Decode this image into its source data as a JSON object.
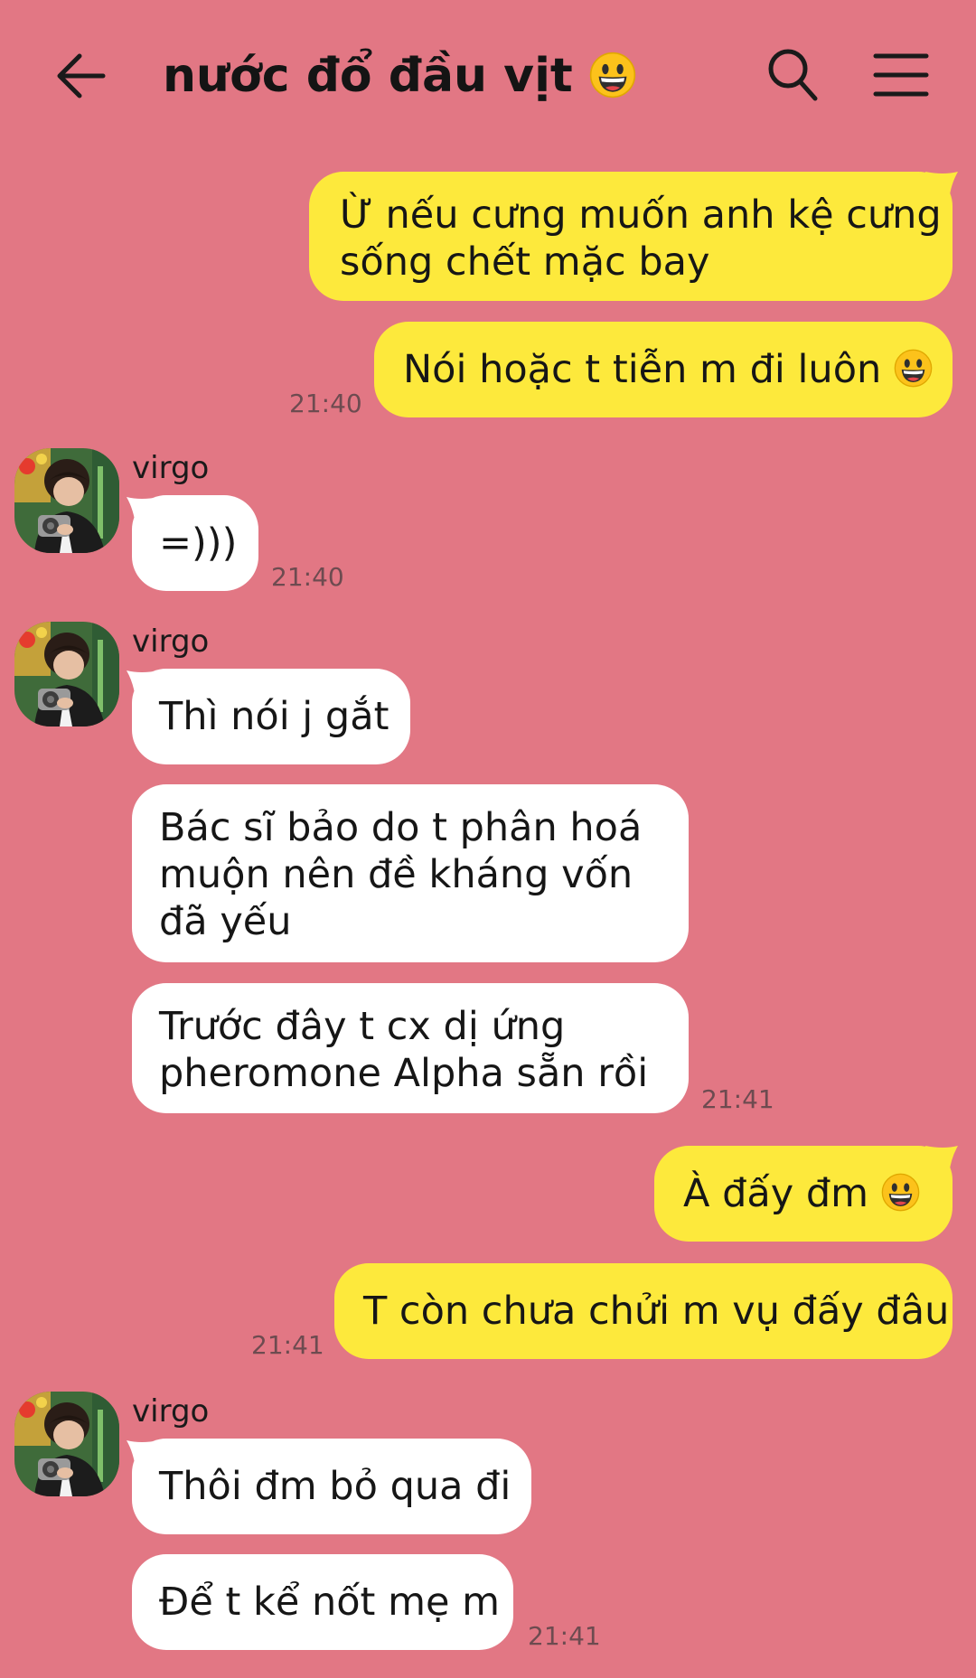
{
  "header": {
    "title": "nước đổ đầu vịt",
    "title_emoji": "grinning-face-emoji"
  },
  "messages": [
    {
      "id": "m1",
      "side": "out",
      "lines": [
        "Ừ nếu cưng muốn anh kệ cưng",
        "sống chết mặc bay"
      ]
    },
    {
      "id": "m2",
      "side": "out",
      "text": "Nói hoặc t tiễn m đi luôn",
      "emoji": "grinning-face-emoji",
      "time": "21:40"
    },
    {
      "id": "m3",
      "side": "in",
      "sender": "virgo",
      "text": "=)))",
      "time": "21:40"
    },
    {
      "id": "m4",
      "side": "in",
      "sender": "virgo",
      "text": "Thì nói j gắt"
    },
    {
      "id": "m5",
      "side": "in",
      "lines": [
        "Bác sĩ bảo do t phân hoá",
        "muộn nên đề kháng vốn",
        "đã yếu"
      ]
    },
    {
      "id": "m6",
      "side": "in",
      "lines": [
        "Trước đây t cx dị ứng",
        "pheromone Alpha sẵn rồi"
      ],
      "time": "21:41"
    },
    {
      "id": "m7",
      "side": "out",
      "text": "À đấy đm",
      "emoji": "grinning-face-emoji"
    },
    {
      "id": "m8",
      "side": "out",
      "text": "T còn chưa chửi m vụ đấy đâu",
      "time": "21:41"
    },
    {
      "id": "m9",
      "side": "in",
      "sender": "virgo",
      "text": "Thôi đm bỏ qua đi"
    },
    {
      "id": "m10",
      "side": "in",
      "text": "Để t kể nốt mẹ m",
      "time": "21:41"
    }
  ],
  "colors": {
    "background": "#e27784",
    "outgoing_bubble": "#fde93c",
    "incoming_bubble": "#ffffff",
    "timestamp": "#6d4b50"
  }
}
